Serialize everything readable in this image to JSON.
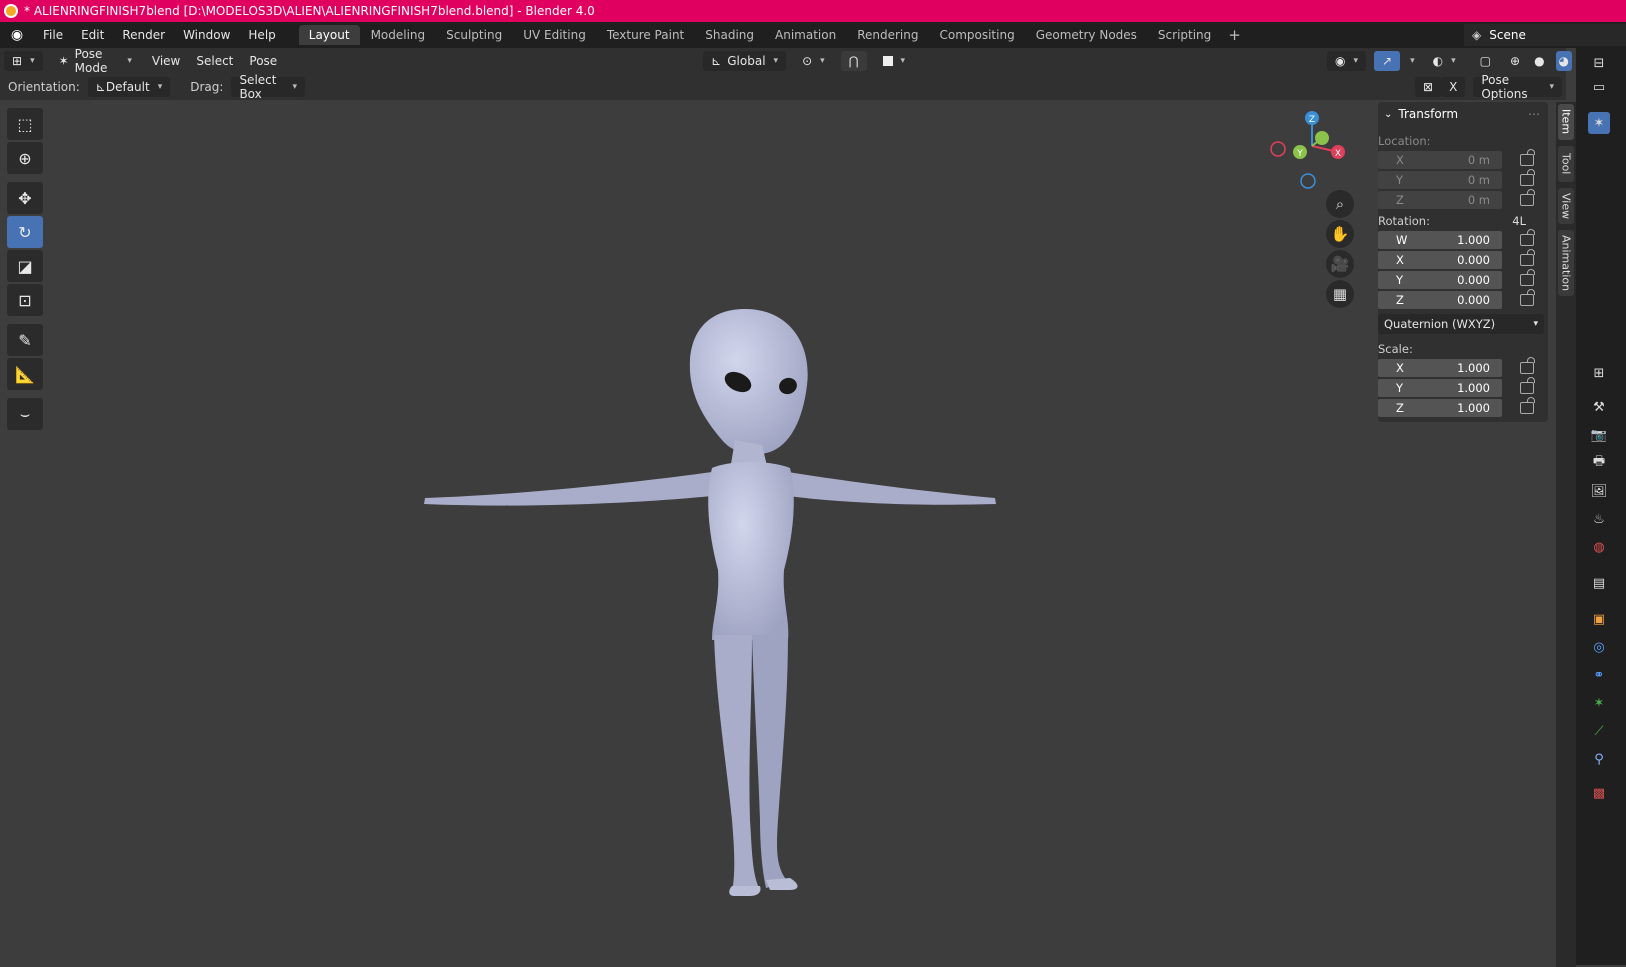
{
  "titlebar": {
    "title": "* ALIENRINGFINISH7blend [D:\\MODELOS3D\\ALIEN\\ALIENRINGFINISH7blend.blend] - Blender 4.0"
  },
  "menubar": {
    "items": [
      "File",
      "Edit",
      "Render",
      "Window",
      "Help"
    ],
    "workspaces": [
      "Layout",
      "Modeling",
      "Sculpting",
      "UV Editing",
      "Texture Paint",
      "Shading",
      "Animation",
      "Rendering",
      "Compositing",
      "Geometry Nodes",
      "Scripting"
    ],
    "active_workspace": "Layout",
    "add_label": "+",
    "scene_label": "Scene"
  },
  "header": {
    "mode": "Pose Mode",
    "menus": [
      "View",
      "Select",
      "Pose"
    ],
    "transform_orientation": "Global"
  },
  "toolheader": {
    "orientation_label": "Orientation:",
    "orientation_value": "Default",
    "drag_label": "Drag:",
    "drag_value": "Select Box",
    "x_toggle": "X",
    "pose_options": "Pose Options"
  },
  "gizmo": {
    "z": "Z",
    "y": "Y",
    "x": "X"
  },
  "npanel": {
    "title": "Transform",
    "location_label": "Location:",
    "location": [
      {
        "axis": "X",
        "value": "0 m"
      },
      {
        "axis": "Y",
        "value": "0 m"
      },
      {
        "axis": "Z",
        "value": "0 m"
      }
    ],
    "rotation_label": "Rotation:",
    "rotation_extra": "4L",
    "rotation": [
      {
        "axis": "W",
        "value": "1.000"
      },
      {
        "axis": "X",
        "value": "0.000"
      },
      {
        "axis": "Y",
        "value": "0.000"
      },
      {
        "axis": "Z",
        "value": "0.000"
      }
    ],
    "rotation_mode": "Quaternion (WXYZ)",
    "scale_label": "Scale:",
    "scale": [
      {
        "axis": "X",
        "value": "1.000"
      },
      {
        "axis": "Y",
        "value": "1.000"
      },
      {
        "axis": "Z",
        "value": "1.000"
      }
    ]
  },
  "sidetabs": [
    "Item",
    "Tool",
    "View",
    "Animation"
  ],
  "colors": {
    "titlebar": "#e0005f",
    "accent": "#4772b3",
    "axis_x": "#e0405a",
    "axis_y": "#8bc34a",
    "axis_z": "#3a8fd6"
  }
}
